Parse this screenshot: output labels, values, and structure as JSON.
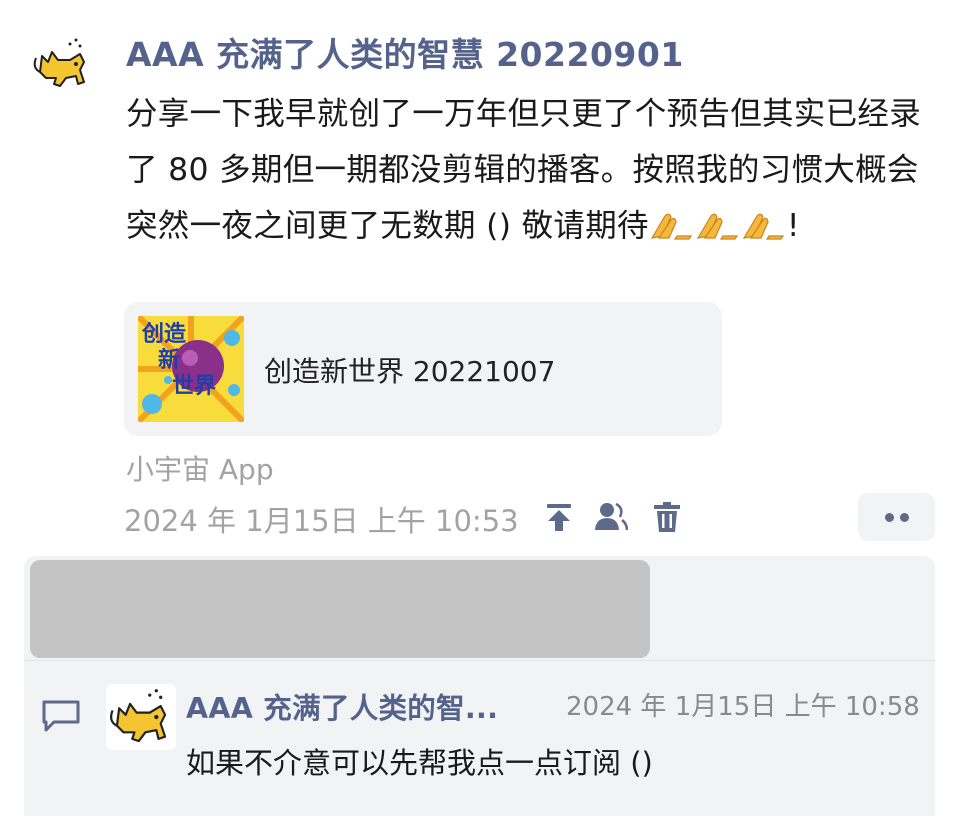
{
  "post": {
    "author": "AAA 充满了人类的智慧 20220901",
    "text": "分享一下我早就创了一万年但只更了个预告但其实已经录了 80 多期但一期都没剪辑的播客。按照我的习惯大概会突然一夜之间更了无数期 () 敬请期待",
    "text_end": "!",
    "emoji": "🙏",
    "card": {
      "title": "创造新世界 20221007",
      "cover_text": [
        "创",
        "造",
        "新",
        "世界"
      ]
    },
    "source": "小宇宙 App",
    "timestamp": "2024 年 1月15日 上午 10:53",
    "icons": [
      "pin-to-top-icon",
      "visibility-icon",
      "delete-icon",
      "more-icon"
    ]
  },
  "comment": {
    "author": "AAA 充满了人类的智...",
    "time": "2024 年 1月15日 上午 10:58",
    "text": "如果不介意可以先帮我点一点订阅 ()"
  },
  "colors": {
    "accent": "#55638c",
    "meta": "#a3a3a3",
    "panel": "#f2f3f5"
  }
}
